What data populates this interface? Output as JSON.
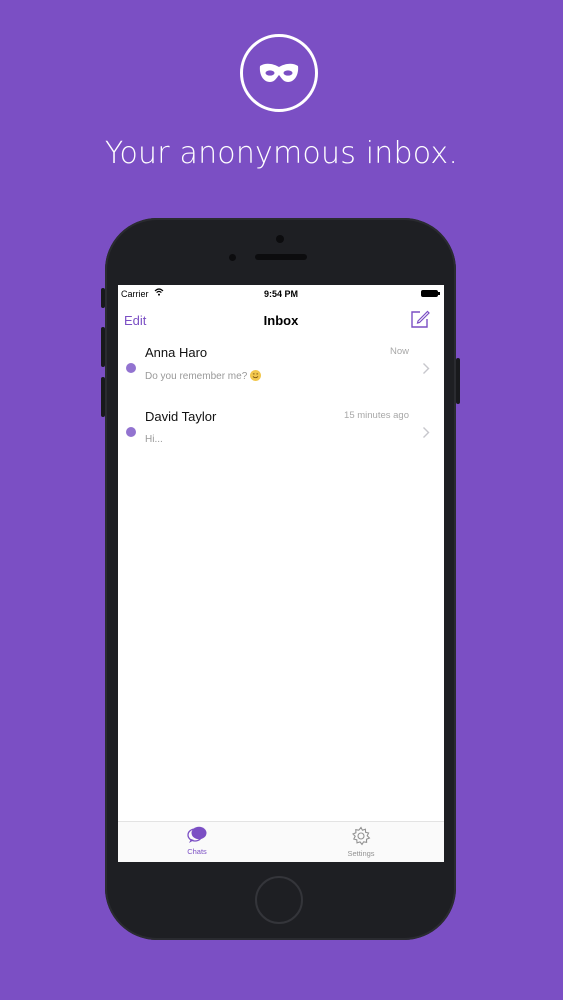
{
  "promo": {
    "logo_icon": "mask-icon",
    "headline": "Your anonymous inbox."
  },
  "status_bar": {
    "carrier": "Carrier",
    "time": "9:54 PM"
  },
  "nav": {
    "edit_label": "Edit",
    "title": "Inbox",
    "compose_icon": "compose-icon"
  },
  "messages": [
    {
      "name": "Anna Haro",
      "preview": "Do you remember me?",
      "time": "Now",
      "unread": true
    },
    {
      "name": "David Taylor",
      "preview": "Hi...",
      "time": "15 minutes ago",
      "unread": true
    }
  ],
  "tabs": [
    {
      "label": "Chats",
      "icon": "chat-bubbles-icon",
      "active": true
    },
    {
      "label": "Settings",
      "icon": "gear-icon",
      "active": false
    }
  ],
  "colors": {
    "background": "#7b4fc4",
    "accent": "#7b4fc4",
    "unread_dot": "#9273d0"
  }
}
